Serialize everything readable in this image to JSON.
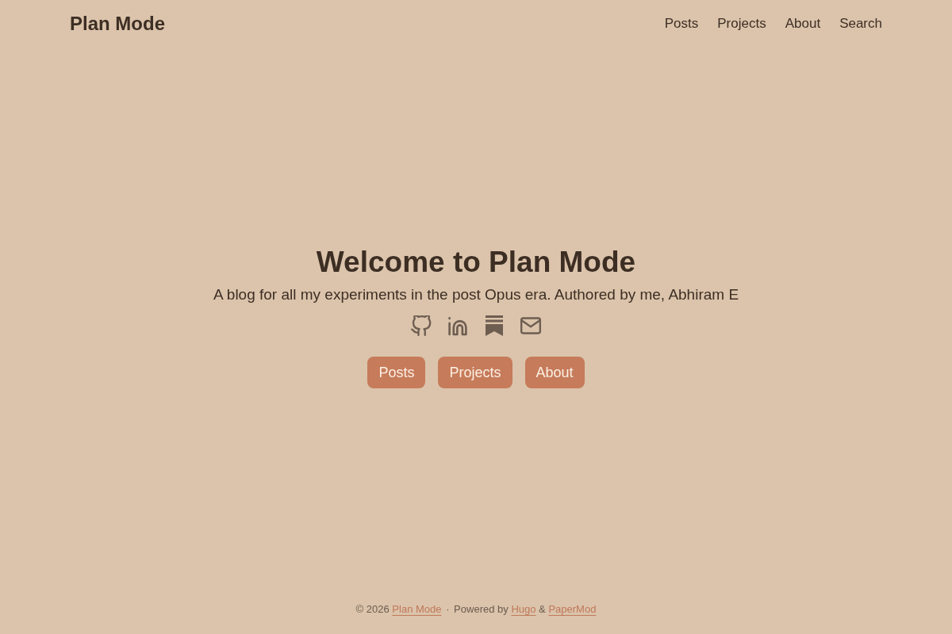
{
  "header": {
    "site_title": "Plan Mode",
    "nav": [
      "Posts",
      "Projects",
      "About",
      "Search"
    ]
  },
  "hero": {
    "title": "Welcome to Plan Mode",
    "subtitle": "A blog for all my experiments in the post Opus era. Authored by me, Abhiram E",
    "buttons": [
      "Posts",
      "Projects",
      "About"
    ]
  },
  "footer": {
    "parts": [
      {
        "kind": "text",
        "text": "© 2026"
      },
      {
        "kind": "link",
        "text": "Plan Mode"
      },
      {
        "kind": "separator",
        "text": "·"
      },
      {
        "kind": "text",
        "text": "Powered by"
      },
      {
        "kind": "link",
        "text": "Hugo"
      },
      {
        "kind": "text",
        "text": "&"
      },
      {
        "kind": "link",
        "text": "PaperMod"
      }
    ]
  }
}
